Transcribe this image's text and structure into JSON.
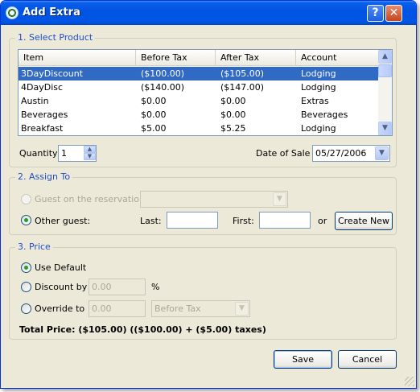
{
  "window": {
    "title": "Add Extra"
  },
  "select_product": {
    "group_label": "1. Select Product",
    "columns": [
      "Item",
      "Before Tax",
      "After Tax",
      "Account"
    ],
    "rows": [
      {
        "item": "3DayDiscount",
        "before_tax": "($100.00)",
        "after_tax": "($105.00)",
        "account": "Lodging"
      },
      {
        "item": "4DayDisc",
        "before_tax": "($140.00)",
        "after_tax": "($147.00)",
        "account": "Lodging"
      },
      {
        "item": "Austin",
        "before_tax": "$0.00",
        "after_tax": "$0.00",
        "account": "Extras"
      },
      {
        "item": "Beverages",
        "before_tax": "$0.00",
        "after_tax": "$0.00",
        "account": "Beverages"
      },
      {
        "item": "Breakfast",
        "before_tax": "$5.00",
        "after_tax": "$5.25",
        "account": "Lodging"
      }
    ],
    "selected_row": 0,
    "quantity_label": "Quantity",
    "quantity_value": "1",
    "date_label": "Date of Sale",
    "date_value": "05/27/2006"
  },
  "assign_to": {
    "group_label": "2. Assign To",
    "guest_on_reservation_label": "Guest on the reservation",
    "guest_on_reservation_value": "",
    "other_guest_label": "Other guest:",
    "last_label": "Last:",
    "last_value": "",
    "first_label": "First:",
    "first_value": "",
    "or_label": "or",
    "create_new_label": "Create New",
    "selected_option": "other_guest"
  },
  "price": {
    "group_label": "3. Price",
    "use_default_label": "Use Default",
    "discount_label": "Discount by",
    "discount_value": "0.00",
    "percent_label": "%",
    "override_label": "Override to",
    "override_value": "0.00",
    "override_mode": "Before Tax",
    "selected_option": "use_default",
    "total_text": "Total Price: ($105.00) (($100.00) + ($5.00) taxes)"
  },
  "buttons": {
    "save_label": "Save",
    "cancel_label": "Cancel"
  },
  "colors": {
    "selection": "#316ac5",
    "group_label": "#1f4ec7",
    "dialog_bg": "#ece9d8"
  }
}
